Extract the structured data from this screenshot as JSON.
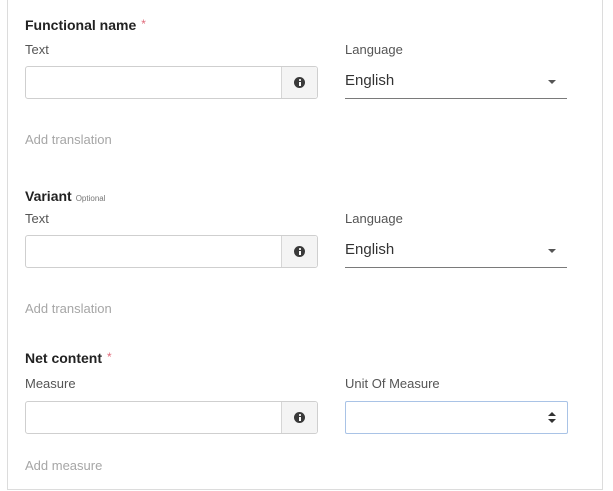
{
  "functional_name": {
    "title": "Functional name",
    "required_mark": "*",
    "text_label": "Text",
    "text_value": "",
    "info_icon": "info-circle-icon",
    "language_label": "Language",
    "language_value": "English",
    "add_link": "Add translation"
  },
  "variant": {
    "title": "Variant",
    "optional_tag": "Optional",
    "text_label": "Text",
    "text_value": "",
    "info_icon": "info-circle-icon",
    "language_label": "Language",
    "language_value": "English",
    "add_link": "Add translation"
  },
  "net_content": {
    "title": "Net content",
    "required_mark": "*",
    "measure_label": "Measure",
    "measure_value": "",
    "info_icon": "info-circle-icon",
    "unit_label": "Unit Of Measure",
    "unit_value": "",
    "add_link": "Add measure"
  },
  "colors": {
    "required": "#e06a7a",
    "muted_link": "#a6a6a6",
    "focus_border": "#a9c3e6"
  }
}
